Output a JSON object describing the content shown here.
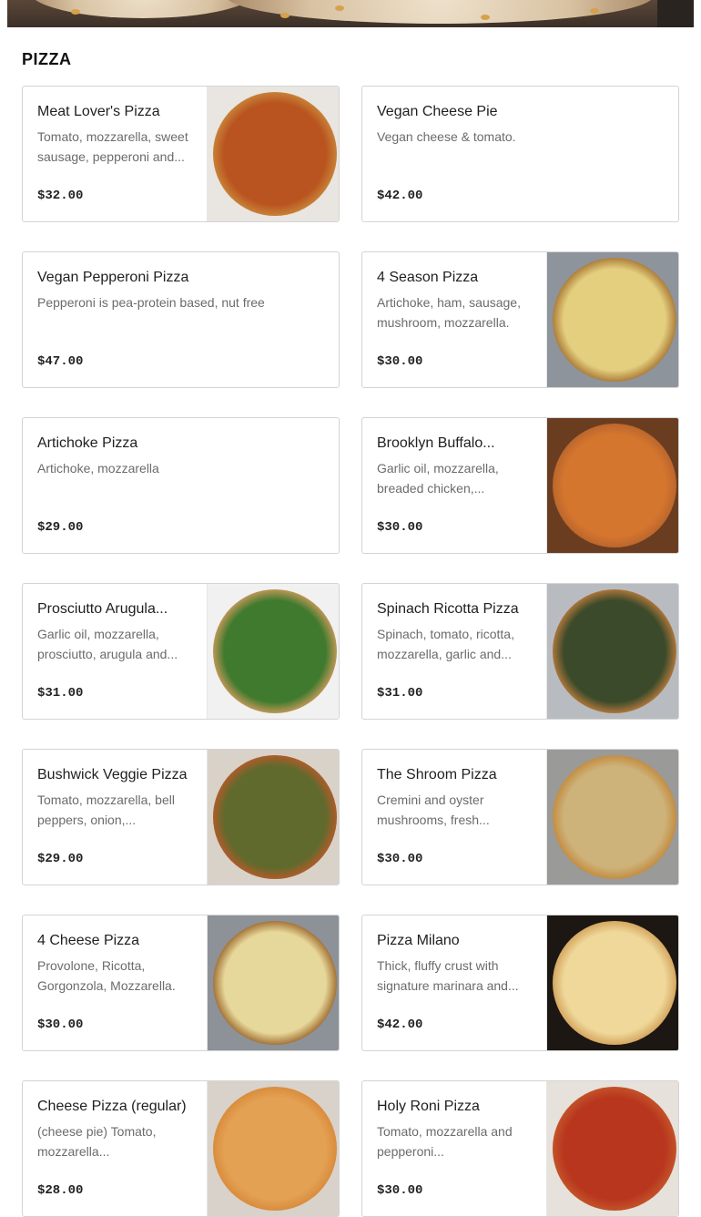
{
  "section": {
    "title": "PIZZA"
  },
  "hero": {
    "image": "pizza-banner-image"
  },
  "items": [
    {
      "name": "Meat Lover's Pizza",
      "description": "Tomato, mozzarella, sweet sausage, pepperoni and...",
      "price": "$32.00",
      "image": "meat-pizza",
      "bg": "#e9e5e0",
      "crust": "#c9863a",
      "top": "#b9531f"
    },
    {
      "name": "Vegan Cheese Pie",
      "description": "Vegan cheese & tomato.",
      "price": "$42.00",
      "image": null
    },
    {
      "name": "Vegan Pepperoni Pizza",
      "description": "Pepperoni is pea-protein based, nut free",
      "price": "$47.00",
      "image": null
    },
    {
      "name": "4 Season Pizza",
      "description": "Artichoke, ham, sausage, mushroom, mozzarella.",
      "price": "$30.00",
      "image": "four-season-pizza",
      "bg": "#8e949c",
      "crust": "#a87634",
      "top": "#e3cf7e"
    },
    {
      "name": "Artichoke Pizza",
      "description": "Artichoke, mozzarella",
      "price": "$29.00",
      "image": null
    },
    {
      "name": "Brooklyn Buffalo...",
      "description": "Garlic oil, mozzarella, breaded chicken,...",
      "price": "$30.00",
      "image": "buffalo-pizza",
      "bg": "#6b3d20",
      "crust": "#b9652d",
      "top": "#d5762e"
    },
    {
      "name": "Prosciutto Arugula...",
      "description": "Garlic oil, mozzarella, prosciutto, arugula and...",
      "price": "$31.00",
      "image": "prosciutto-pizza",
      "bg": "#f1f1f1",
      "crust": "#c99a5a",
      "top": "#3f7a2e"
    },
    {
      "name": "Spinach Ricotta Pizza",
      "description": "Spinach, tomato, ricotta, mozzarella, garlic and...",
      "price": "$31.00",
      "image": "spinach-pizza",
      "bg": "#b8bcc0",
      "crust": "#b77a3c",
      "top": "#3b4a2a"
    },
    {
      "name": "Bushwick Veggie Pizza",
      "description": "Tomato, mozzarella, bell peppers, onion,...",
      "price": "$29.00",
      "image": "veggie-pizza",
      "bg": "#d9d2c8",
      "crust": "#b55b2a",
      "top": "#5f6a2c"
    },
    {
      "name": "The Shroom Pizza",
      "description": "Cremini and oyster mushrooms, fresh...",
      "price": "$30.00",
      "image": "shroom-pizza",
      "bg": "#9a9a98",
      "crust": "#c38a3c",
      "top": "#cdb27a"
    },
    {
      "name": "4 Cheese Pizza",
      "description": "Provolone, Ricotta, Gorgonzola, Mozzarella.",
      "price": "$30.00",
      "image": "four-cheese-pizza",
      "bg": "#8d9198",
      "crust": "#9e6a2e",
      "top": "#e6d79a"
    },
    {
      "name": "Pizza Milano",
      "description": "Thick, fluffy crust with signature marinara and...",
      "price": "$42.00",
      "image": "milano-pizza",
      "bg": "#1c1712",
      "crust": "#d2a25a",
      "top": "#efd89a"
    },
    {
      "name": "Cheese Pizza (regular)",
      "description": "(cheese pie) Tomato, mozzarella...",
      "price": "$28.00",
      "image": "cheese-pizza",
      "bg": "#d8d2ca",
      "crust": "#d98a3a",
      "top": "#e3a154"
    },
    {
      "name": "Holy Roni Pizza",
      "description": "Tomato, mozzarella and pepperoni...",
      "price": "$30.00",
      "image": "pepperoni-pizza",
      "bg": "#e6e1da",
      "crust": "#c4552a",
      "top": "#b8361e"
    }
  ]
}
